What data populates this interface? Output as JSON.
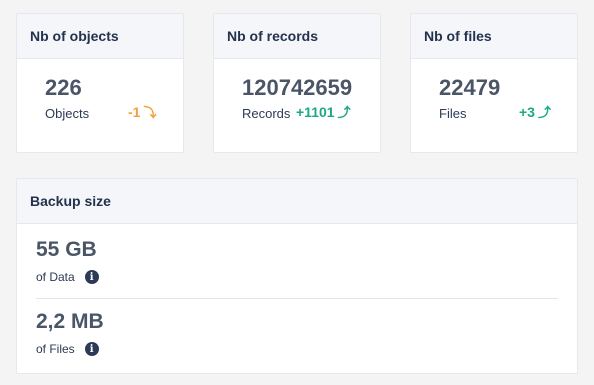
{
  "cards": {
    "objects": {
      "title": "Nb of objects",
      "value": "226",
      "label": "Objects",
      "delta": "-1",
      "delta_direction": "down",
      "delta_icon": "arrow-down-icon"
    },
    "records": {
      "title": "Nb of records",
      "value": "120742659",
      "label": "Records",
      "delta": "+1101",
      "delta_direction": "up",
      "delta_icon": "arrow-up-icon"
    },
    "files": {
      "title": "Nb of files",
      "value": "22479",
      "label": "Files",
      "delta": "+3",
      "delta_direction": "up",
      "delta_icon": "arrow-up-icon"
    }
  },
  "backup": {
    "title": "Backup size",
    "data": {
      "value": "55 GB",
      "label": "of Data",
      "icon": "info-icon"
    },
    "files": {
      "value": "2,2 MB",
      "label": "of Files",
      "icon": "info-icon"
    }
  },
  "colors": {
    "negative": "#f0a23a",
    "positive": "#1ba886",
    "header_bg": "#f5f6fa",
    "page_bg": "#f4f4f5"
  }
}
